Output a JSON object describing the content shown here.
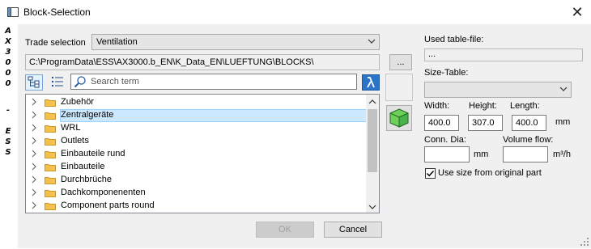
{
  "window": {
    "title": "Block-Selection",
    "close_glyph": "✕"
  },
  "side_label": [
    "A",
    "X",
    "3",
    "0",
    "0",
    "0",
    "-",
    "E",
    "S",
    "S"
  ],
  "trade": {
    "label": "Trade selection",
    "value": "Ventilation"
  },
  "path": {
    "value": "C:\\ProgramData\\ESS\\AX3000.b_EN\\K_Data_EN\\LUEFTUNG\\BLOCKS\\",
    "browse_label": "..."
  },
  "search": {
    "placeholder": "Search term"
  },
  "tree": {
    "items": [
      {
        "label": "Zubehör",
        "selected": false
      },
      {
        "label": "Zentralgeräte",
        "selected": true
      },
      {
        "label": "WRL",
        "selected": false
      },
      {
        "label": "Outlets",
        "selected": false
      },
      {
        "label": "Einbauteile rund",
        "selected": false
      },
      {
        "label": "Einbauteile",
        "selected": false
      },
      {
        "label": "Durchbrüche",
        "selected": false
      },
      {
        "label": "Dachkomponenenten",
        "selected": false
      },
      {
        "label": "Component parts round",
        "selected": false
      }
    ]
  },
  "buttons": {
    "ok": "OK",
    "cancel": "Cancel"
  },
  "right": {
    "used_table_label": "Used table-file:",
    "used_table_value": "...",
    "size_table_label": "Size-Table:",
    "size_table_value": "",
    "width_label": "Width:",
    "height_label": "Height:",
    "length_label": "Length:",
    "width_value": "400.0",
    "height_value": "307.0",
    "length_value": "400.0",
    "unit_mm": "mm",
    "conn_dia_label": "Conn. Dia:",
    "conn_dia_value": "",
    "conn_unit": "mm",
    "volume_flow_label": "Volume flow:",
    "volume_flow_value": "",
    "volume_unit": "m³/h",
    "use_size_label": "Use size from original part",
    "use_size_checked": true
  },
  "colors": {
    "accent": "#0078d7",
    "cube": "#49b04a",
    "folder": "#f2c14e"
  }
}
